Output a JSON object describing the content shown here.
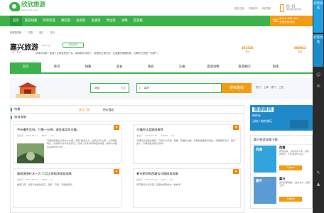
{
  "header": {
    "brand": "欣欣旅游",
    "url": "www.cncn.com",
    "links": [
      "登录/注册",
      "切换城市",
      "网站导航"
    ],
    "app_title": "扫一扫",
    "app_sub": "手机游玩更优惠"
  },
  "nav": {
    "items": [
      "首页",
      "旅游线路",
      "欣欣优选",
      "跟团游",
      "自助游",
      "主题游",
      "周边游",
      "攻略",
      "百宝箱"
    ],
    "active_index": 0,
    "phone": "400-6-166-166",
    "phone_sub": "全国免费咨询"
  },
  "breadcrumb": [
    "欣欣旅游网",
    "中国",
    "浙江",
    "嘉兴"
  ],
  "city": {
    "name": "嘉兴旅游",
    "pinyin": "Jiaxing",
    "follow": "关注嘉兴",
    "temp": "2°C",
    "weather": "晴",
    "blurb": "浓厚的乌镇一起漫了云和夜里的少女，倒映着写诗意人 · 南湖的云烟又如一位温柔的南国阿妹，回眸在古桥里一同看千...",
    "stats": [
      {
        "value": "453526",
        "label": "关注"
      },
      {
        "value": "868063",
        "label": "去过"
      }
    ]
  },
  "tabs": [
    "首页",
    "景点",
    "线路",
    "美食",
    "住宿",
    "交通",
    "旅游攻略",
    "旅游顾问",
    "指南"
  ],
  "search": {
    "city": "北京",
    "city_hint": "出发",
    "query": "嘉兴",
    "button": "搜索路线",
    "hot": [
      "热门",
      "上海",
      "厦门",
      "三亚"
    ]
  },
  "section": {
    "title": "特惠",
    "tabs": [
      "景点门票",
      "特价酒店"
    ]
  },
  "guides_title": "旅游攻略",
  "cards": [
    {
      "title": "不吐槽不会排，只需一分钟，速览真实的乌镇...",
      "author": "发表于：2016-06-11",
      "views": "8690",
      "comments": "12",
      "badge": "精",
      "desc": "乌镇是典型的江南水乡古镇，素有\"鱼米之乡，丝绸之府\"之称。从周朝到明清，悠悠两千余年历史积淀，形成了许多具有特色的民居，被称为中国最后的枕水人家..."
    },
    {
      "title": "乌镇四日游路线推荐",
      "author": "发表于：2015-07-15",
      "views": "15900",
      "comments": "16",
      "badge": "精",
      "desc": "乌镇四日游路线推荐：乌镇分为东栅、西栅，南栅和北栅。东栅和西栅各有特色，西栅保存完好，夜景迷人；东栅则更加原汁原味..."
    },
    {
      "title": "烟雨濛濛在水一方 六月江南纯净旅游攻略",
      "author": "发表于：2015-08-09",
      "views": "9868",
      "comments": "9",
      "badge": "精",
      "desc": "烟雨江南，最有名的便是周庄，西塘，乌镇，乌镇的夜景..."
    },
    {
      "title": "春节期间到西塘去乌镇旅游攻略",
      "author": "发表于：2016-02-11",
      "views": "4000",
      "comments": "26",
      "badge": "精",
      "desc": "春节期间为到乌镇，西塘的游客提供一些参考..."
    }
  ],
  "sidebar": {
    "ad_title": "旅游顾问",
    "ad_line1": "带你去",
    "ad_line2": "当地人带你游玩",
    "guide_title": "嘉兴旅游攻略下载",
    "guides": [
      {
        "cover": "西塘",
        "title": "西塘",
        "desc": "西塘古镇，小桥流水人家，很好的地方，不知道说什么好...",
        "btn": "下载PDF"
      },
      {
        "cover": "嘉兴",
        "title": "嘉兴",
        "desc": "嘉兴旅游攻略，\"鱼米之乡，丝绸之府\"...",
        "btn": "下载PDF"
      }
    ]
  },
  "rail": {
    "label": "欣欣优选",
    "label2": "欣欣优选"
  }
}
